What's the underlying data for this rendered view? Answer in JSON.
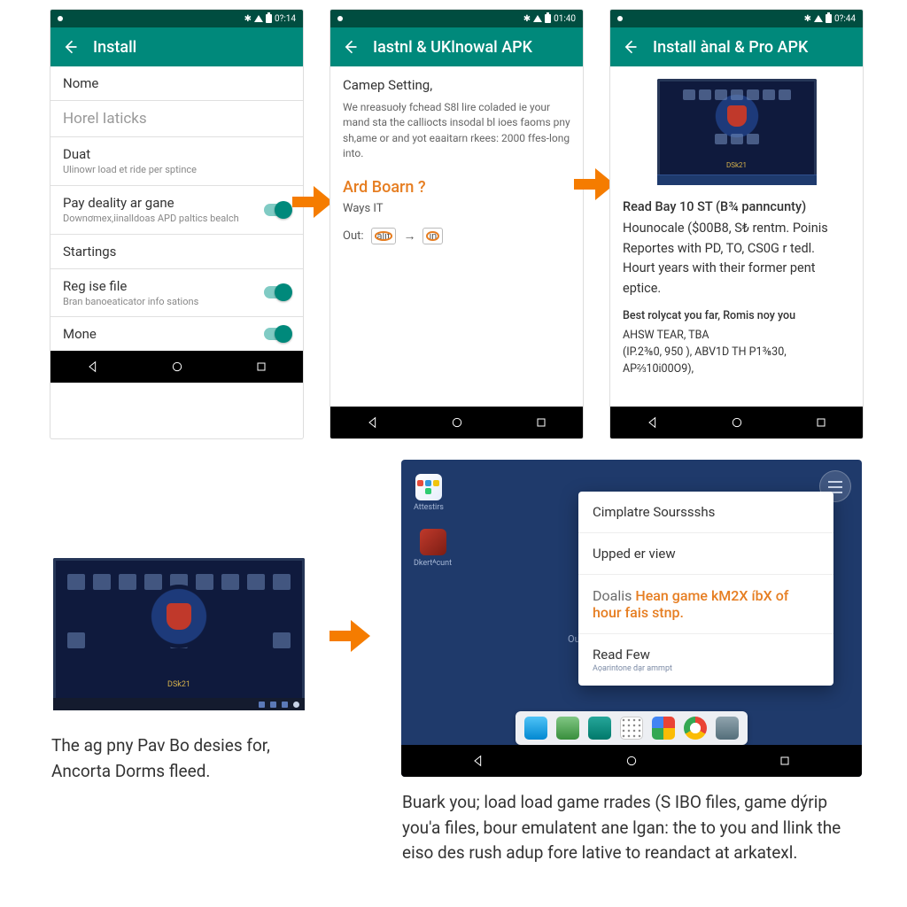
{
  "phone1": {
    "status_time": "0?:14",
    "title": "Install",
    "rows": [
      {
        "title": "Nome"
      },
      {
        "title": "Horel Iaticks",
        "muted": true
      },
      {
        "title": "Duat",
        "sub": "Ulinowr load et ride per sptince"
      },
      {
        "title": "Pay deality ar gane",
        "sub": "Downơmex,iinalldoas APD paltics bealch",
        "switch": true
      },
      {
        "title": "Startings"
      },
      {
        "title": "Reg ise file",
        "sub": "Bran banoeaticator info sations",
        "switch": true
      },
      {
        "title": "Mone",
        "switch": true
      }
    ]
  },
  "phone2": {
    "status_time": "01:40",
    "title": "Iastnl & UKlnowal APK",
    "setting_label": "Camep Setting,",
    "setting_switch_on": true,
    "para": "We nreasuoły fchead S8l lire coladed ie your mand sta the calliocts insodal bl ioes faoms pny sh,ame or and yot eaaitarn rkees: 2000 ffes-long into.",
    "question": "Ard Boarn ?",
    "ways_label": "Ways IT",
    "out_label": "Out:",
    "pill1": "alit",
    "pill2": "in"
  },
  "phone3": {
    "status_time": "0?:44",
    "title": "Install ànal & Pro APK",
    "video_caption": "DSk21",
    "body1_bold": "Read Bay 10 ST (B¾ panncunty)",
    "body1": "Hounocale ($00B8, S₺ rentm. Poinis Reportes with PD, TO, CS0G r tedl. Hourt years with their former pent eptice.",
    "body2_bold": "Best rolycat you far, Romis noy you",
    "body2": "AHSW TEAR, TBA\n(IP.2⅜0, 950 ), ABV1D TH P1⅜30, AP⅔10i00O9),"
  },
  "bottom_caption1": "The ag pny Pav Bo desies for, Ancorta Dorms fleed.",
  "tablet": {
    "icon1_label": "Attestirs",
    "icon2_label": "Dkertᴬcunt",
    "ctx": [
      {
        "text": "Cimplatre Sourssshs"
      },
      {
        "text": "Upped er view"
      },
      {
        "highlight": true,
        "prefix": "Doalis  ",
        "text": "Hean game kM2X íbX of hour fais stnp."
      },
      {
        "text": "Read Few",
        "aux": "Aọarintone dạr ammpt"
      }
    ],
    "out_label": "Out"
  },
  "bottom_caption2": "Buark you; load load game rrades (S IBO files, game dýrip you'a files, bour emulatent ane lgan: the to you and llink the eiso des rush adup fore lative to reandact at arkatexl."
}
